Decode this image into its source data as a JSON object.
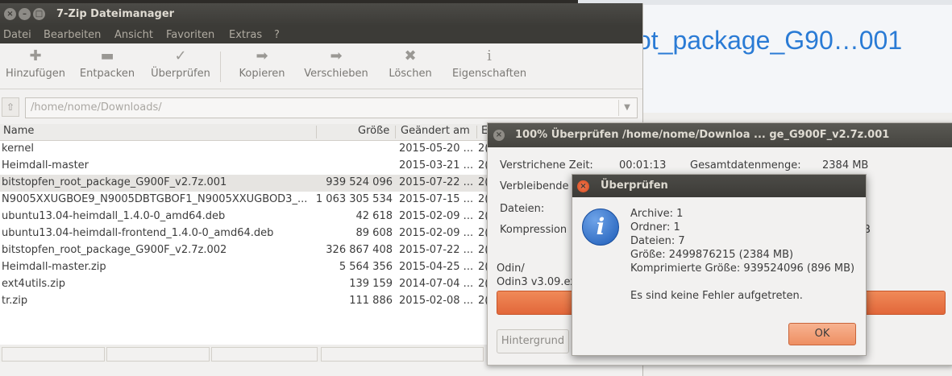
{
  "background": {
    "browser_title": "ot_package_G90…001"
  },
  "main_window": {
    "title": "7-Zip Dateimanager",
    "window_buttons": {
      "close": "×",
      "minimize": "–",
      "maximize": "□"
    },
    "menu": [
      "Datei",
      "Bearbeiten",
      "Ansicht",
      "Favoriten",
      "Extras",
      "?"
    ],
    "toolbar": [
      {
        "label": "Hinzufügen",
        "icon": "plus-icon",
        "glyph": "✚"
      },
      {
        "label": "Entpacken",
        "icon": "minus-icon",
        "glyph": "▬"
      },
      {
        "label": "Überprüfen",
        "icon": "check-icon",
        "glyph": "✓"
      },
      {
        "label": "Kopieren",
        "icon": "copy-arrow-icon",
        "glyph": "➡"
      },
      {
        "label": "Verschieben",
        "icon": "move-arrow-icon",
        "glyph": "➡"
      },
      {
        "label": "Löschen",
        "icon": "delete-x-icon",
        "glyph": "✖"
      },
      {
        "label": "Eigenschaften",
        "icon": "info-icon",
        "glyph": "i"
      }
    ],
    "path": {
      "value": "/home/nome/Downloads/",
      "up_glyph": "⇧",
      "dropdown_glyph": "▼"
    },
    "columns": {
      "name": "Name",
      "size": "Größe",
      "modified": "Geändert am",
      "extra": "E"
    },
    "files": [
      {
        "name": "kernel",
        "size": "",
        "date": "2015-05-20 ...",
        "extra": "2("
      },
      {
        "name": "Heimdall-master",
        "size": "",
        "date": "2015-03-21 ...",
        "extra": "2("
      },
      {
        "name": "bitstopfen_root_package_G900F_v2.7z.001",
        "size": "939 524 096",
        "date": "2015-07-22 ...",
        "extra": "2("
      },
      {
        "name": "N9005XXUGBOE9_N9005DBTGBOF1_N9005XXUGBOD3_...",
        "size": "1 063 305 534",
        "date": "2015-07-15 ...",
        "extra": "2("
      },
      {
        "name": "ubuntu13.04-heimdall_1.4.0-0_amd64.deb",
        "size": "42 618",
        "date": "2015-02-09 ...",
        "extra": "2("
      },
      {
        "name": "ubuntu13.04-heimdall-frontend_1.4.0-0_amd64.deb",
        "size": "89 608",
        "date": "2015-02-09 ...",
        "extra": "2("
      },
      {
        "name": "bitstopfen_root_package_G900F_v2.7z.002",
        "size": "326 867 408",
        "date": "2015-07-22 ...",
        "extra": "2("
      },
      {
        "name": "Heimdall-master.zip",
        "size": "5 564 356",
        "date": "2015-04-25 ...",
        "extra": "2("
      },
      {
        "name": "ext4utils.zip",
        "size": "139 159",
        "date": "2014-07-04 ...",
        "extra": "2("
      },
      {
        "name": "tr.zip",
        "size": "111 886",
        "date": "2015-02-08 ...",
        "extra": "2("
      }
    ]
  },
  "progress_dialog": {
    "title": "100% Überprüfen /home/nome/Downloa ... ge_G900F_v2.7z.001",
    "close_glyph": "×",
    "elapsed_label": "Verstrichene Zeit:",
    "elapsed_value": "00:01:13",
    "total_label": "Gesamtdatenmenge:",
    "total_value": "2384 MB",
    "remaining_label": "Verbleibende",
    "files_label": "Dateien:",
    "compression_label": "Kompression",
    "compression_tail": "B",
    "current_path_1": "Odin/",
    "current_path_2": "Odin3 v3.09.ex",
    "progress": 1.0,
    "background_button": "Hintergrund"
  },
  "info_dialog": {
    "title": "Überprüfen",
    "close_glyph": "×",
    "icon_glyph": "i",
    "lines": [
      "Archive: 1",
      "Ordner: 1",
      "Dateien: 7",
      "Größe: 2499876215 (2384 MB)",
      "Komprimierte Größe: 939524096 (896 MB)"
    ],
    "message": "Es sind keine Fehler aufgetreten.",
    "ok_label": "OK"
  }
}
